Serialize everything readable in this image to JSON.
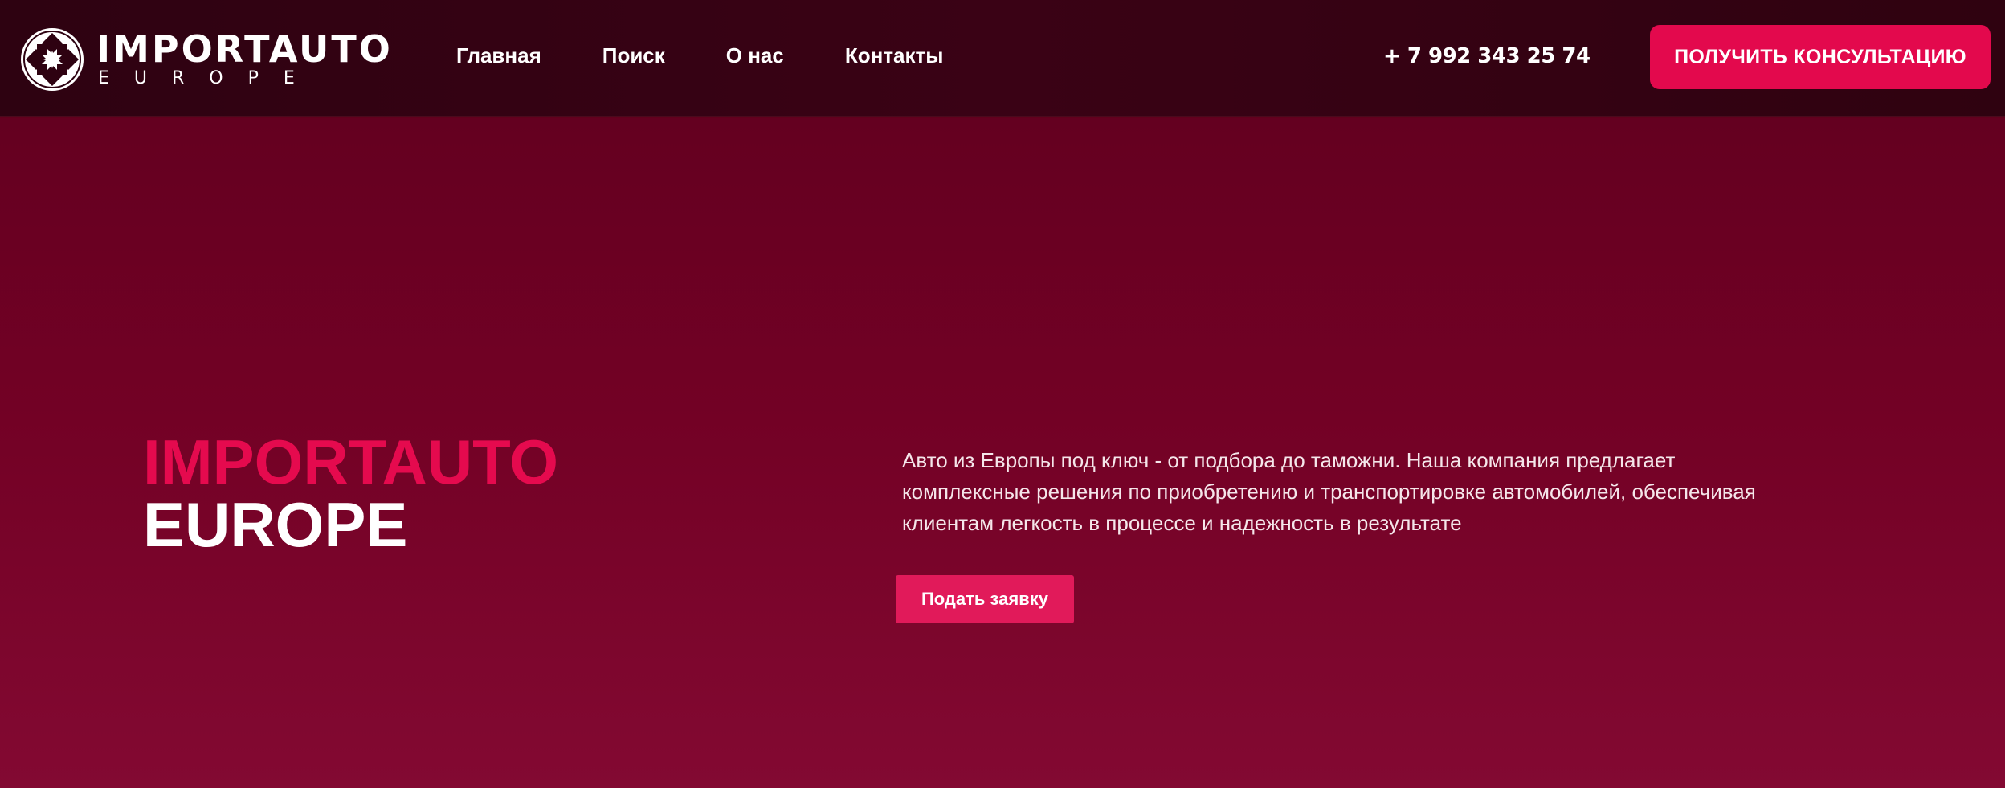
{
  "header": {
    "logo": {
      "icon": "diamond-cross-logo-icon",
      "main": "IMPORTAUTO",
      "sub": "EUROPE"
    },
    "nav": [
      {
        "label": "Главная"
      },
      {
        "label": "Поиск"
      },
      {
        "label": "О нас"
      },
      {
        "label": "Контакты"
      }
    ],
    "phone": "+ 7 992 343 25 74",
    "consult_button": "ПОЛУЧИТЬ КОНСУЛЬТАЦИЮ"
  },
  "hero": {
    "title_line1": "IMPORTAUTO",
    "title_line2": "EUROPE",
    "description": "Авто из Европы под ключ - от подбора до таможни. Наша компания предлагает комплексные решения по приобретению и транспортировке автомобилей, обеспечивая клиентам легкость в процессе и надежность в результате",
    "apply_button": "Подать заявку"
  },
  "colors": {
    "accent": "#e3094d",
    "header_bg": "#2e0211",
    "hero_bg_top": "#640020",
    "hero_bg_bottom": "#830932"
  }
}
